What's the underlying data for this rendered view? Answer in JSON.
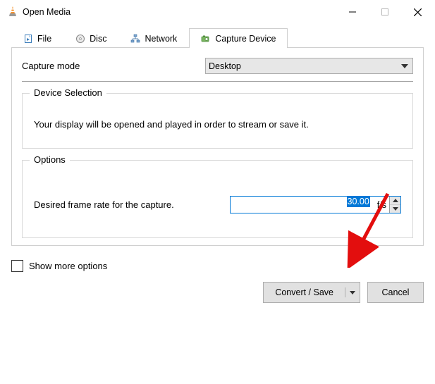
{
  "window": {
    "title": "Open Media"
  },
  "tabs": {
    "file": {
      "label": "File"
    },
    "disc": {
      "label": "Disc"
    },
    "network": {
      "label": "Network"
    },
    "capture": {
      "label": "Capture Device"
    }
  },
  "capture_panel": {
    "mode_label": "Capture mode",
    "mode_value": "Desktop",
    "device_selection": {
      "legend": "Device Selection",
      "desc": "Your display will be opened and played in order to stream or save it."
    },
    "options": {
      "legend": "Options",
      "rate_label": "Desired frame rate for the capture.",
      "rate_value": "30.00",
      "rate_unit": "f/s"
    }
  },
  "footer": {
    "show_more": "Show more options",
    "convert": "Convert / Save",
    "cancel": "Cancel"
  }
}
